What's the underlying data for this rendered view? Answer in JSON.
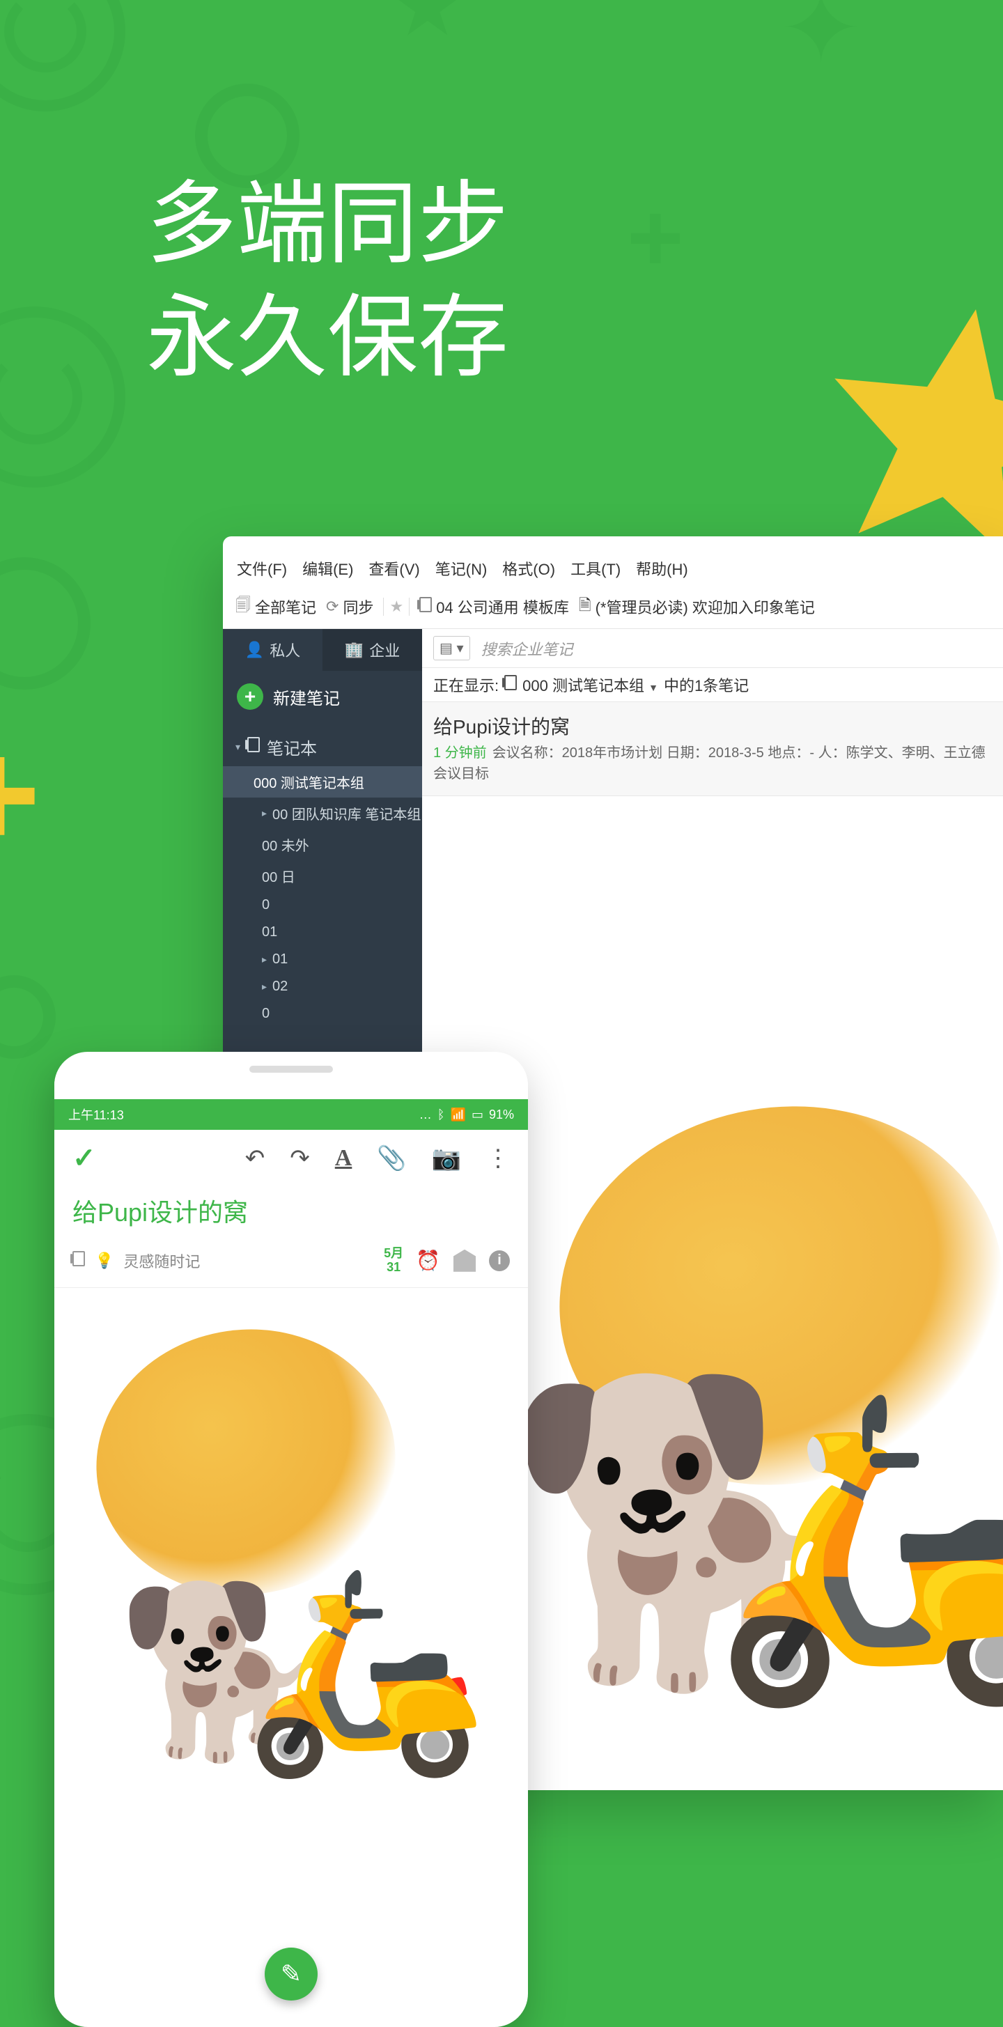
{
  "hero": {
    "line1": "多端同步",
    "line2": "永久保存"
  },
  "desktop": {
    "menus": [
      "文件(F)",
      "编辑(E)",
      "查看(V)",
      "笔记(N)",
      "格式(O)",
      "工具(T)",
      "帮助(H)"
    ],
    "toolbar": {
      "all_notes": "全部笔记",
      "sync": "同步",
      "crumb": "04 公司通用 模板库",
      "crumb2": "(*管理员必读) 欢迎加入印象笔记"
    },
    "sidebar": {
      "tab_personal": "私人",
      "tab_enterprise": "企业",
      "new_note": "新建笔记",
      "section_notebooks": "笔记本",
      "items": [
        {
          "label": "000 测试笔记本组",
          "selected": true
        },
        {
          "label": "00 团队知识库 笔记本组"
        },
        {
          "label": "00 未外"
        },
        {
          "label": "00 日"
        },
        {
          "label": "0"
        },
        {
          "label": "01"
        },
        {
          "label": "01"
        },
        {
          "label": "02"
        },
        {
          "label": "0"
        }
      ]
    },
    "search_placeholder": "搜索企业笔记",
    "showing": {
      "prefix": "正在显示:",
      "notebook": "000 测试笔记本组",
      "suffix": "中的1条笔记"
    },
    "note": {
      "title": "给Pupi设计的窝",
      "time": "1 分钟前",
      "meta": "会议名称：2018年市场计划 日期：2018-3-5 地点：- 人：陈学文、李明、王立德 会议目标"
    }
  },
  "mobile": {
    "status_time": "上午11:13",
    "battery": "91%",
    "title": "给Pupi设计的窝",
    "notebook_hint": "灵感随时记",
    "date": {
      "month": "5月",
      "day": "31"
    }
  }
}
